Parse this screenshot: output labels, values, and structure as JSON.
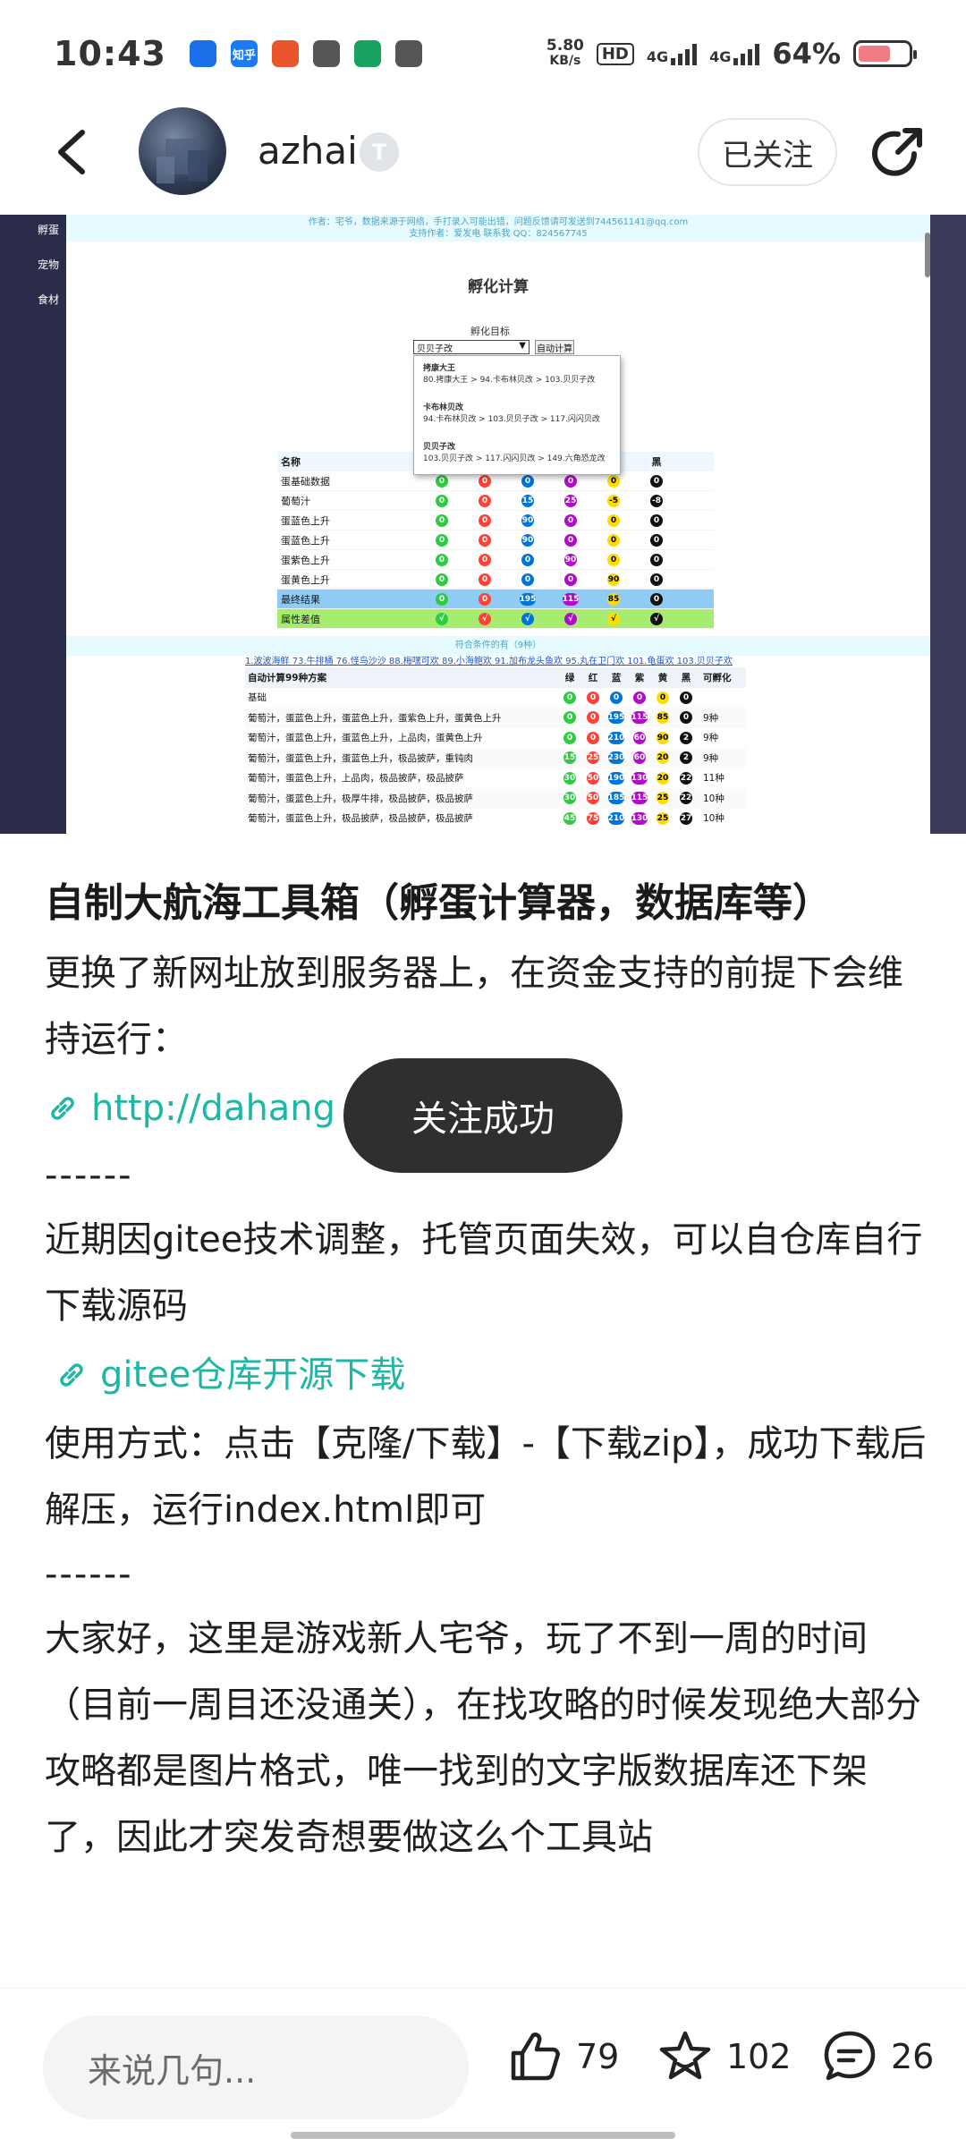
{
  "status_bar": {
    "time": "10:43",
    "notification_icons": [
      {
        "name": "browser-icon",
        "label": "",
        "color": "#1b6fe8"
      },
      {
        "name": "zhihu-icon",
        "label": "知乎",
        "color": "#1a7bf2"
      },
      {
        "name": "game-icon",
        "label": "",
        "color": "#e8542c"
      },
      {
        "name": "app-icon",
        "label": "",
        "color": "#555555"
      },
      {
        "name": "money-icon",
        "label": "",
        "color": "#1aa260"
      },
      {
        "name": "gallery-icon",
        "label": "",
        "color": "#555555"
      }
    ],
    "net_speed_value": "5.80",
    "net_speed_unit": "KB/s",
    "hd_label": "HD",
    "sim1_label": "4G",
    "sim2_label": "4G",
    "battery": "64%",
    "battery_level": 0.64
  },
  "header": {
    "username": "azhai",
    "level_badge": "T",
    "follow_label": "已关注"
  },
  "screenshot": {
    "sidebar": [
      "孵蛋",
      "宠物",
      "食材"
    ],
    "top_notice_1": "作者：宅爷，数据来源于网络，手打录入可能出错，问题反馈请可发送到744561141@qq.com",
    "top_notice_2": "支持作者：爱发电  联系我 QQ：824567745",
    "title": "孵化计算",
    "target_label": "孵化目标",
    "select_value": "贝贝子改",
    "calc_button": "自动计算",
    "dropdown": [
      {
        "name": "拷康大王",
        "path": "80.拷康大王 > 94.卡布林贝改 > 103.贝贝子改"
      },
      {
        "name": "卡布林贝改",
        "path": "94.卡布林贝改 > 103.贝贝子改 > 117.闪闪贝改"
      },
      {
        "name": "贝贝子改",
        "path": "103.贝贝子改 > 117.闪闪贝改 > 149.六角恐龙改"
      }
    ],
    "table_header": [
      "名称",
      "绿",
      "红",
      "蓝",
      "紫",
      "黄",
      "黑"
    ],
    "rows": [
      {
        "name": "蛋基础数据",
        "v": [
          "0",
          "0",
          "0",
          "0",
          "0",
          "0"
        ]
      },
      {
        "name": "葡萄汁",
        "v": [
          "0",
          "0",
          "15",
          "25",
          "-5",
          "-8"
        ]
      },
      {
        "name": "蛋蓝色上升",
        "v": [
          "0",
          "0",
          "90",
          "0",
          "0",
          "0"
        ]
      },
      {
        "name": "蛋蓝色上升",
        "v": [
          "0",
          "0",
          "90",
          "0",
          "0",
          "0"
        ]
      },
      {
        "name": "蛋紫色上升",
        "v": [
          "0",
          "0",
          "0",
          "90",
          "0",
          "0"
        ]
      },
      {
        "name": "蛋黄色上升",
        "v": [
          "0",
          "0",
          "0",
          "0",
          "90",
          "0"
        ]
      },
      {
        "name": "最终结果",
        "v": [
          "0",
          "0",
          "195",
          "115",
          "85",
          "0"
        ]
      },
      {
        "name": "属性差值",
        "v": [
          "√",
          "√",
          "√",
          "√",
          "√",
          "√"
        ]
      }
    ],
    "band_text": "符合条件的有（9种）",
    "links_text": "1.波波海鲜 73.牛排桶 76.怪鸟沙沙 88.梅嘿可欢 89.小海鲍欢 91.加布龙头鱼欢 95.丸在卫门欢 101.龟蛋欢 103.贝贝子欢",
    "auto_header": {
      "plan": "自动计算99种方案",
      "cols": [
        "绿",
        "红",
        "蓝",
        "紫",
        "黄",
        "黑"
      ],
      "possible": "可孵化"
    },
    "auto_rows": [
      {
        "plan": "基础",
        "v": [
          "0",
          "0",
          "0",
          "0",
          "0",
          "0"
        ],
        "t": ""
      },
      {
        "plan": "葡萄汁，蛋蓝色上升，蛋蓝色上升，蛋紫色上升，蛋黄色上升",
        "v": [
          "0",
          "0",
          "195",
          "115",
          "85",
          "0"
        ],
        "t": "9种"
      },
      {
        "plan": "葡萄汁，蛋蓝色上升，蛋蓝色上升，上品肉，蛋黄色上升",
        "v": [
          "0",
          "0",
          "210",
          "60",
          "90",
          "2"
        ],
        "t": "9种"
      },
      {
        "plan": "葡萄汁，蛋蓝色上升，蛋蓝色上升，极品披萨，重钝肉",
        "v": [
          "15",
          "25",
          "230",
          "60",
          "20",
          "2"
        ],
        "t": "9种"
      },
      {
        "plan": "葡萄汁，蛋蓝色上升，上品肉，极品披萨，极品披萨",
        "v": [
          "30",
          "50",
          "190",
          "130",
          "20",
          "22"
        ],
        "t": "11种"
      },
      {
        "plan": "葡萄汁，蛋蓝色上升，极厚牛排，极品披萨，极品披萨",
        "v": [
          "30",
          "50",
          "185",
          "115",
          "25",
          "22"
        ],
        "t": "10种"
      },
      {
        "plan": "葡萄汁，蛋蓝色上升，极品披萨，极品披萨，极品披萨",
        "v": [
          "45",
          "75",
          "210",
          "130",
          "25",
          "27"
        ],
        "t": "10种"
      }
    ]
  },
  "article": {
    "title": "自制大航海工具箱（孵蛋计算器，数据库等）",
    "p1": "更换了新网址放到服务器上，在资金支持的前提下会维持运行：",
    "link1": "http://dahang",
    "sep1": "------",
    "p2": "近期因gitee技术调整，托管页面失效，可以自仓库自行下载源码",
    "link2": "gitee仓库开源下载",
    "p3": "使用方式：点击【克隆/下载】-【下载zip】，成功下载后解压，运行index.html即可",
    "sep2": "------",
    "p4": "大家好，这里是游戏新人宅爷，玩了不到一周的时间（目前一周目还没通关），在找攻略的时候发现绝大部分攻略都是图片格式，唯一找到的文字版数据库还下架了，因此才突发奇想要做这么个工具站"
  },
  "toast": "关注成功",
  "bottom": {
    "comment_placeholder": "来说几句...",
    "likes": "79",
    "favorites": "102",
    "comments": "26"
  },
  "colors": {
    "accent_link": "#1cb8a5",
    "toast_bg": "#2f2f2f"
  }
}
